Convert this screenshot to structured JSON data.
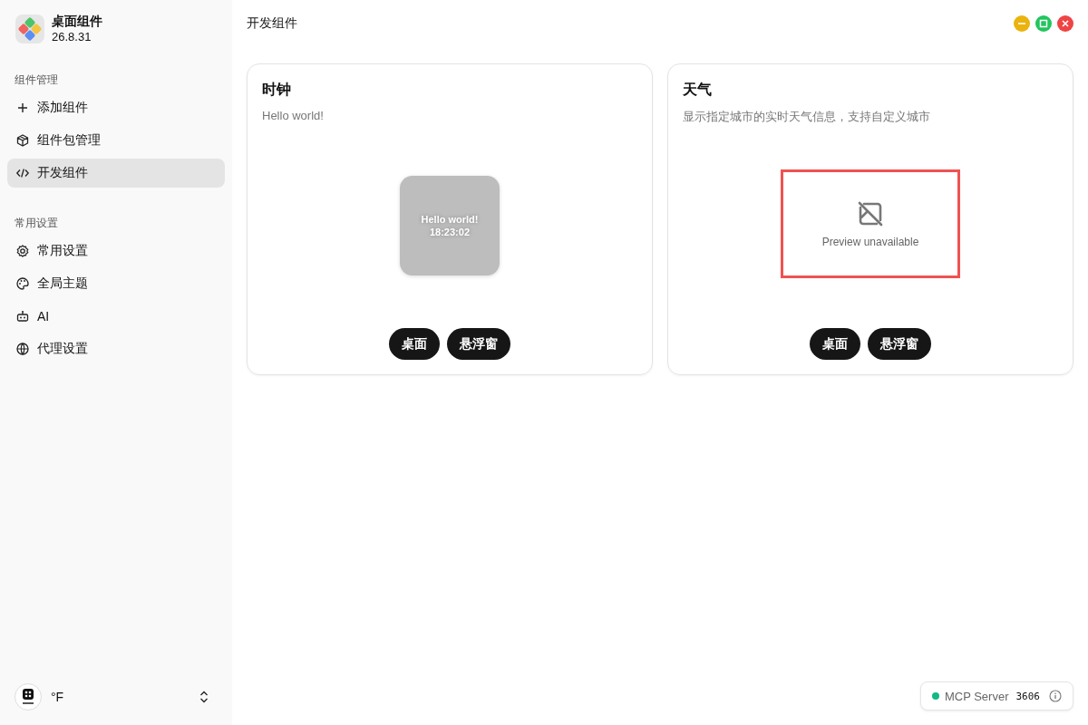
{
  "app": {
    "name": "桌面组件",
    "version": "26.8.31"
  },
  "sidebar": {
    "sections": [
      {
        "title": "组件管理",
        "items": [
          {
            "label": "添加组件",
            "kind": "plus",
            "selected": false
          },
          {
            "label": "组件包管理",
            "kind": "package",
            "selected": false
          },
          {
            "label": "开发组件",
            "kind": "code",
            "selected": true
          }
        ]
      },
      {
        "title": "常用设置",
        "items": [
          {
            "label": "常用设置",
            "kind": "gear",
            "selected": false
          },
          {
            "label": "全局主题",
            "kind": "palette",
            "selected": false
          },
          {
            "label": "AI",
            "kind": "robot",
            "selected": false
          },
          {
            "label": "代理设置",
            "kind": "globe",
            "selected": false
          }
        ]
      }
    ],
    "footer": {
      "label": "°F"
    }
  },
  "page": {
    "title": "开发组件"
  },
  "cards": [
    {
      "title": "时钟",
      "description": "Hello world!",
      "preview": {
        "kind": "clock",
        "lines": [
          "Hello world!",
          "18:23:02"
        ]
      },
      "buttons": [
        "桌面",
        "悬浮窗"
      ]
    },
    {
      "title": "天气",
      "description": "显示指定城市的实时天气信息，支持自定义城市",
      "preview": {
        "kind": "unavailable",
        "lines": [
          "Preview unavailable"
        ]
      },
      "buttons": [
        "桌面",
        "悬浮窗"
      ]
    }
  ],
  "status": {
    "label": "MCP Server",
    "port": "3606",
    "color": "#12b886"
  }
}
